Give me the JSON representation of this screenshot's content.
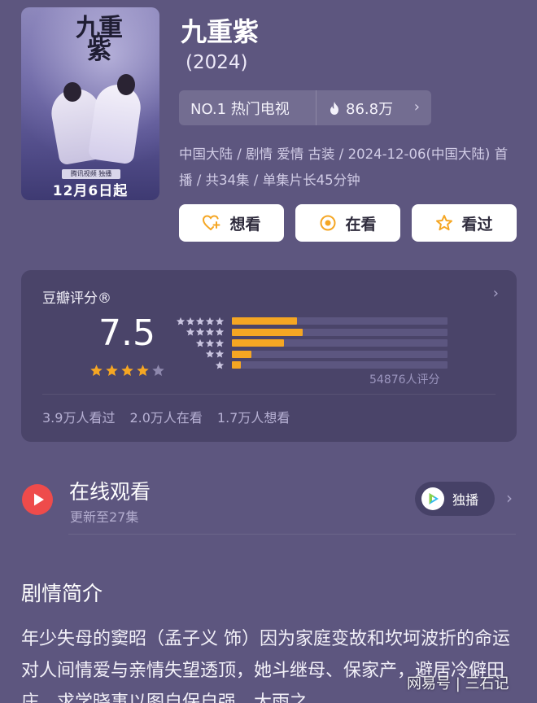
{
  "poster": {
    "calligraphy": "九重紫",
    "tag": "腾讯视频 独播",
    "date": "12月6日起"
  },
  "show": {
    "title": "九重紫",
    "year": "(2024)",
    "rank": "NO.1 热门电视",
    "heat": "86.8万",
    "meta": "中国大陆 / 剧情 爱情 古装 / 2024-12-06(中国大陆) 首播 / 共34集 / 单集片长45分钟"
  },
  "actions": {
    "want": "想看",
    "watching": "在看",
    "watched": "看过"
  },
  "rating": {
    "label": "豆瓣评分®",
    "score": "7.5",
    "stars": 3.75,
    "distribution": [
      0.3,
      0.33,
      0.24,
      0.09,
      0.04
    ],
    "count": "54876人评分",
    "watched": "3.9万人看过",
    "watching": "2.0万人在看",
    "want": "1.7万人想看"
  },
  "online": {
    "title": "在线观看",
    "subtitle": "更新至27集",
    "badge": "独播"
  },
  "synopsis": {
    "heading": "剧情简介",
    "text": "年少失母的窦昭（孟子义 饰）因为家庭变故和坎坷波折的命运对人间情爱与亲情失望透顶，她斗继母、保家产，避居冷僻田庄，求学晓事以图自保自强。大雨之"
  },
  "watermark": "网易号 | 三石记",
  "colors": {
    "background": "#5d567f",
    "card": "#4a4469",
    "accent": "#f5a623",
    "play": "#ee4b4b"
  }
}
